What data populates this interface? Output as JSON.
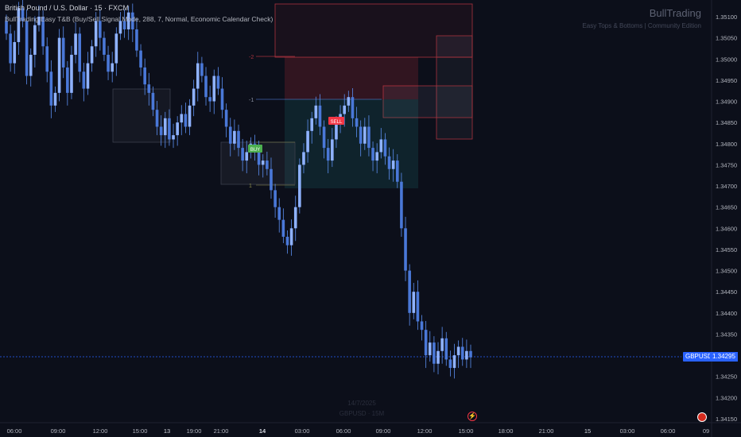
{
  "header": {
    "symbol_title": "British Pound / U.S. Dollar · 15 · FXCM",
    "indicator_line": "BullTrading Easy T&B (Buy/Sell Signal Mode, 288, 7, Normal, Economic Calendar Check)"
  },
  "branding": {
    "name": "BullTrading",
    "subtitle": "Easy Tops & Bottoms | Community Edition"
  },
  "watermark": {
    "date": "14/7/2025",
    "symbol": "GBPUSD · 15M"
  },
  "current_price": {
    "symbol_label": "GBPUSD",
    "value": "1.34295"
  },
  "signals": {
    "buy_label": "BUY",
    "sell_label": "SELL"
  },
  "level_labels": [
    "-2",
    "-1",
    "1",
    "1"
  ],
  "colors": {
    "background": "#0c0f1a",
    "candle": "#5b8ef0",
    "accent": "#2962ff",
    "sell": "#f23645",
    "buy": "#4caf50"
  },
  "chart_data": {
    "type": "candlestick",
    "y_ticks": [
      "1.35100",
      "1.35050",
      "1.35000",
      "1.34950",
      "1.34900",
      "1.34850",
      "1.34800",
      "1.34750",
      "1.34700",
      "1.34650",
      "1.34600",
      "1.34550",
      "1.34500",
      "1.34450",
      "1.34400",
      "1.34350",
      "1.34300",
      "1.34250",
      "1.34200",
      "1.34150"
    ],
    "x_ticks": [
      "06:00",
      "09:00",
      "12:00",
      "15:00",
      "13",
      "19:00",
      "21:00",
      "14",
      "03:00",
      "06:00",
      "09:00",
      "12:00",
      "15:00",
      "18:00",
      "21:00",
      "15",
      "03:00",
      "06:00",
      "09"
    ],
    "ylim": [
      1.3414,
      1.3513
    ],
    "close": [
      1.3506,
      1.3499,
      1.3504,
      1.3512,
      1.3509,
      1.3496,
      1.3501,
      1.3508,
      1.351,
      1.3503,
      1.3497,
      1.3489,
      1.3492,
      1.3505,
      1.3498,
      1.3492,
      1.3501,
      1.3506,
      1.3497,
      1.3493,
      1.3499,
      1.3503,
      1.3509,
      1.3505,
      1.3501,
      1.3497,
      1.3499,
      1.3506,
      1.3509,
      1.3507,
      1.3511,
      1.3507,
      1.3502,
      1.3498,
      1.3494,
      1.3492,
      1.3488,
      1.3484,
      1.3482,
      1.3486,
      1.3481,
      1.3482,
      1.3485,
      1.3487,
      1.3484,
      1.3489,
      1.3493,
      1.3499,
      1.3496,
      1.3491,
      1.349,
      1.3496,
      1.3493,
      1.3488,
      1.3484,
      1.348,
      1.3483,
      1.3479,
      1.3476,
      1.3478,
      1.348,
      1.3478,
      1.3475,
      1.3476,
      1.3474,
      1.3469,
      1.3465,
      1.3462,
      1.3458,
      1.3456,
      1.346,
      1.3465,
      1.3475,
      1.3478,
      1.3483,
      1.3486,
      1.3489,
      1.3484,
      1.3479,
      1.3476,
      1.3481,
      1.3485,
      1.3487,
      1.3489,
      1.3491,
      1.3486,
      1.3484,
      1.348,
      1.3484,
      1.3479,
      1.3476,
      1.3478,
      1.3481,
      1.3477,
      1.3474,
      1.3476,
      1.3471,
      1.346,
      1.345,
      1.344,
      1.3445,
      1.3438,
      1.3436,
      1.343,
      1.3433,
      1.3428,
      1.3431,
      1.3434,
      1.3429,
      1.3427,
      1.343,
      1.3432,
      1.3429,
      1.3431,
      1.34295
    ]
  }
}
